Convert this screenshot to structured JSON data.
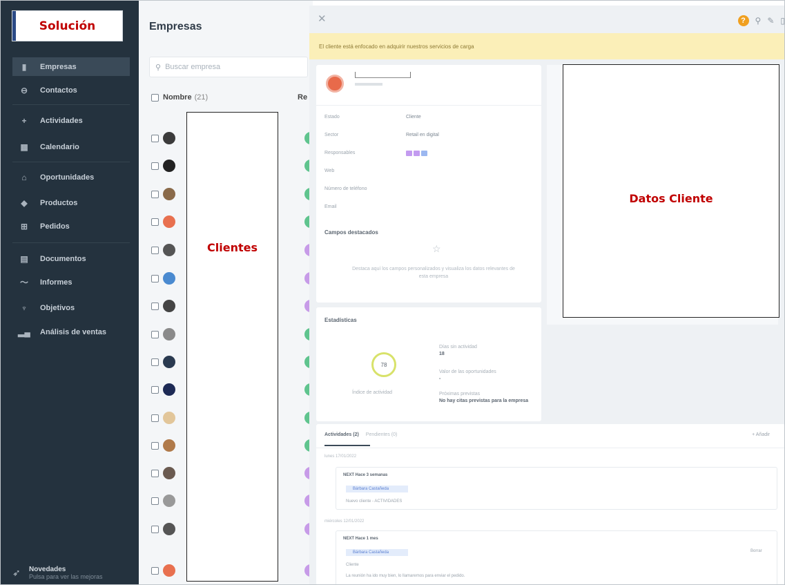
{
  "sidebar": {
    "brand_label": "Solución",
    "items": [
      {
        "label": "Empresas",
        "icon": "building-icon"
      },
      {
        "label": "Contactos",
        "icon": "contact-icon"
      },
      {
        "label": "Actividades",
        "icon": "plus-icon"
      },
      {
        "label": "Calendario",
        "icon": "calendar-icon"
      },
      {
        "label": "Oportunidades",
        "icon": "bank-icon"
      },
      {
        "label": "Productos",
        "icon": "tag-icon"
      },
      {
        "label": "Pedidos",
        "icon": "cart-icon"
      },
      {
        "label": "Documentos",
        "icon": "document-icon"
      },
      {
        "label": "Informes",
        "icon": "chart-line-icon"
      },
      {
        "label": "Objetivos",
        "icon": "trophy-icon"
      },
      {
        "label": "Análisis de ventas",
        "icon": "bar-chart-icon"
      }
    ],
    "news_title": "Novedades",
    "news_subtitle": "Pulsa para ver las mejoras"
  },
  "list": {
    "title": "Empresas",
    "search_placeholder": "Buscar empresa",
    "col_name": "Nombre",
    "count": "(21)",
    "col_resp": "Re"
  },
  "annotation": {
    "clientes_label": "Clientes",
    "datos_cliente_label": "Datos Cliente"
  },
  "panel": {
    "banner_text": "El cliente está enfocado en adquirir nuestros servicios de carga",
    "fields": [
      {
        "label": "Estado",
        "value": "Cliente"
      },
      {
        "label": "Sector",
        "value": "Retail en digital"
      },
      {
        "label": "Responsables",
        "value": ""
      },
      {
        "label": "Web",
        "value": ""
      },
      {
        "label": "Número de teléfono",
        "value": ""
      },
      {
        "label": "Email",
        "value": ""
      }
    ],
    "custom_fields_title": "Campos destacados",
    "custom_fields_text": "Destaca aquí los campos personalizados y visualiza los datos relevantes de esta empresa",
    "stats_title": "Estadísticas",
    "activity_index": "78",
    "activity_index_label": "Índice de actividad",
    "days_label": "Días sin actividad",
    "days_value": "18",
    "opp_label": "Valor de las oportunidades",
    "opp_value": "-",
    "next_label": "Próximas previstas",
    "next_value": "No hay citas previstas para la empresa",
    "tab_activities": "Actividades (2)",
    "tab_other": "Pendientes (0)",
    "add_label": "+ Añadir",
    "date1": "lunes 17/01/2022",
    "act1_title": "NEXT Hace 3 semanas",
    "act1_chip": "Bárbara Castañeda",
    "act1_line": "Nuevo cliente - ACTIVIDADES",
    "date2": "miércoles 12/01/2022",
    "act2_title": "NEXT Hace 1 mes",
    "act2_chip": "Bárbara Castañeda",
    "act2_line1": "Cliente",
    "act2_line2": "La reunión ha ido muy bien, lo llamaremos para enviar el pedido.",
    "act2_more": "Borrar"
  },
  "colors": {
    "sidebar_bg": "#24323e",
    "annotation_red": "#c00000",
    "banner_bg": "#fbefb8"
  }
}
